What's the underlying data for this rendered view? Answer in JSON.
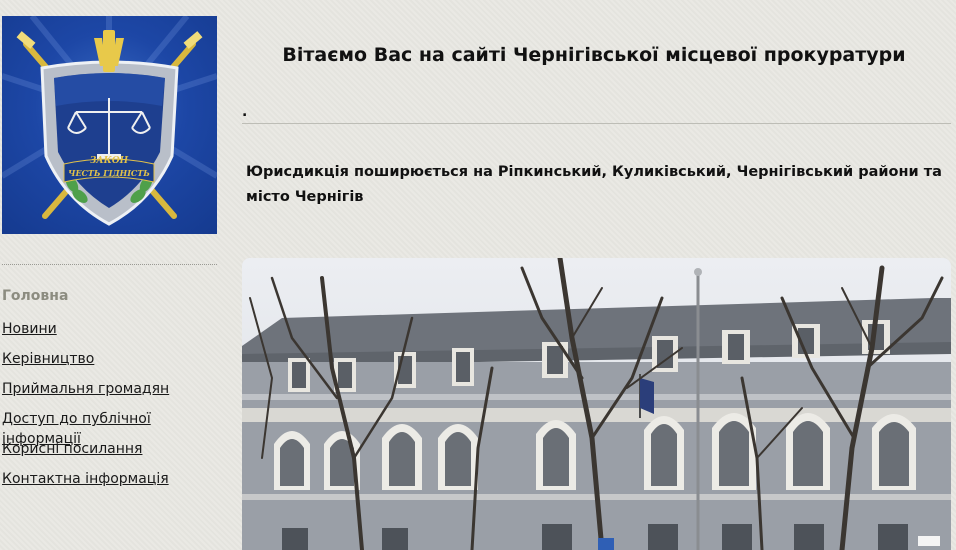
{
  "logo": {
    "emblem_text_line1": "ЗАКОН",
    "emblem_text_line2": "ЧЕСТЬ ГІДНІСТЬ",
    "colors": {
      "background": "#1d47a6",
      "gold": "#e2c24a",
      "silver": "#c7ccd4"
    }
  },
  "header": {
    "welcome": "Вітаємо Вас на сайті Чернігівської місцевої прокуратури",
    "dot": "."
  },
  "main": {
    "jurisdiction": "Юрисдикція поширюється на Ріпкинський, Куликівський, Чернігівський райони та місто Чернігів"
  },
  "nav": {
    "home": "Головна",
    "items": [
      "Новини",
      "Керівництво",
      "Приймальня громадян",
      "Доступ до публічної інформації",
      "Корисні посилання",
      "Контактна інформація"
    ]
  },
  "photo": {
    "icon": "building-photo",
    "colors": {
      "facade": "#9aa0a8",
      "trim": "#e6e4df",
      "roof": "#70757d",
      "sky": "#e4e7ec"
    }
  }
}
